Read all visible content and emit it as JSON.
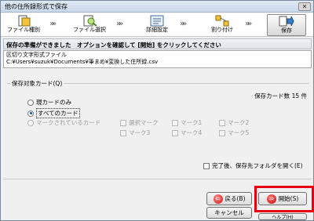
{
  "window": {
    "title": "他の住所録形式で保存",
    "close_symbol": "✕"
  },
  "steps": [
    {
      "label": "ファイル種別",
      "icon": "file-type-icon"
    },
    {
      "label": "ファイル選択",
      "icon": "file-select-icon"
    },
    {
      "label": "詳細設定",
      "icon": "details-icon"
    },
    {
      "label": "割り付け",
      "icon": "mapping-icon"
    },
    {
      "label": "保存",
      "icon": "save-icon"
    }
  ],
  "step_arrow": "»»",
  "instruction": "保存の準備ができました　オプションを確認して [開始] をクリックしてください",
  "info": {
    "line1": "区切り文字形式ファイル",
    "line2": "C:¥Users¥suzuk¥Documents¥筆まめ¥変換した住所録.csv"
  },
  "target_cards": {
    "group_label": "保存対象カード(Q)",
    "count_text": "保存カード数 15 件",
    "options": {
      "current": "現カードのみ",
      "all": "すべてのカード",
      "marked": "マークされているカード"
    },
    "marks": [
      "選択マーク",
      "マーク1",
      "マーク2",
      "マーク3",
      "マーク4",
      "マーク5"
    ]
  },
  "open_folder_label": "完了後、保存先フォルダを開く(E)",
  "buttons": {
    "back": "戻る(B)",
    "start": "開始(S)",
    "cancel": "キャンセル",
    "help": "ヘルプ(H)"
  },
  "colors": {
    "highlight": "#e60012",
    "accent": "#1d4f91"
  }
}
